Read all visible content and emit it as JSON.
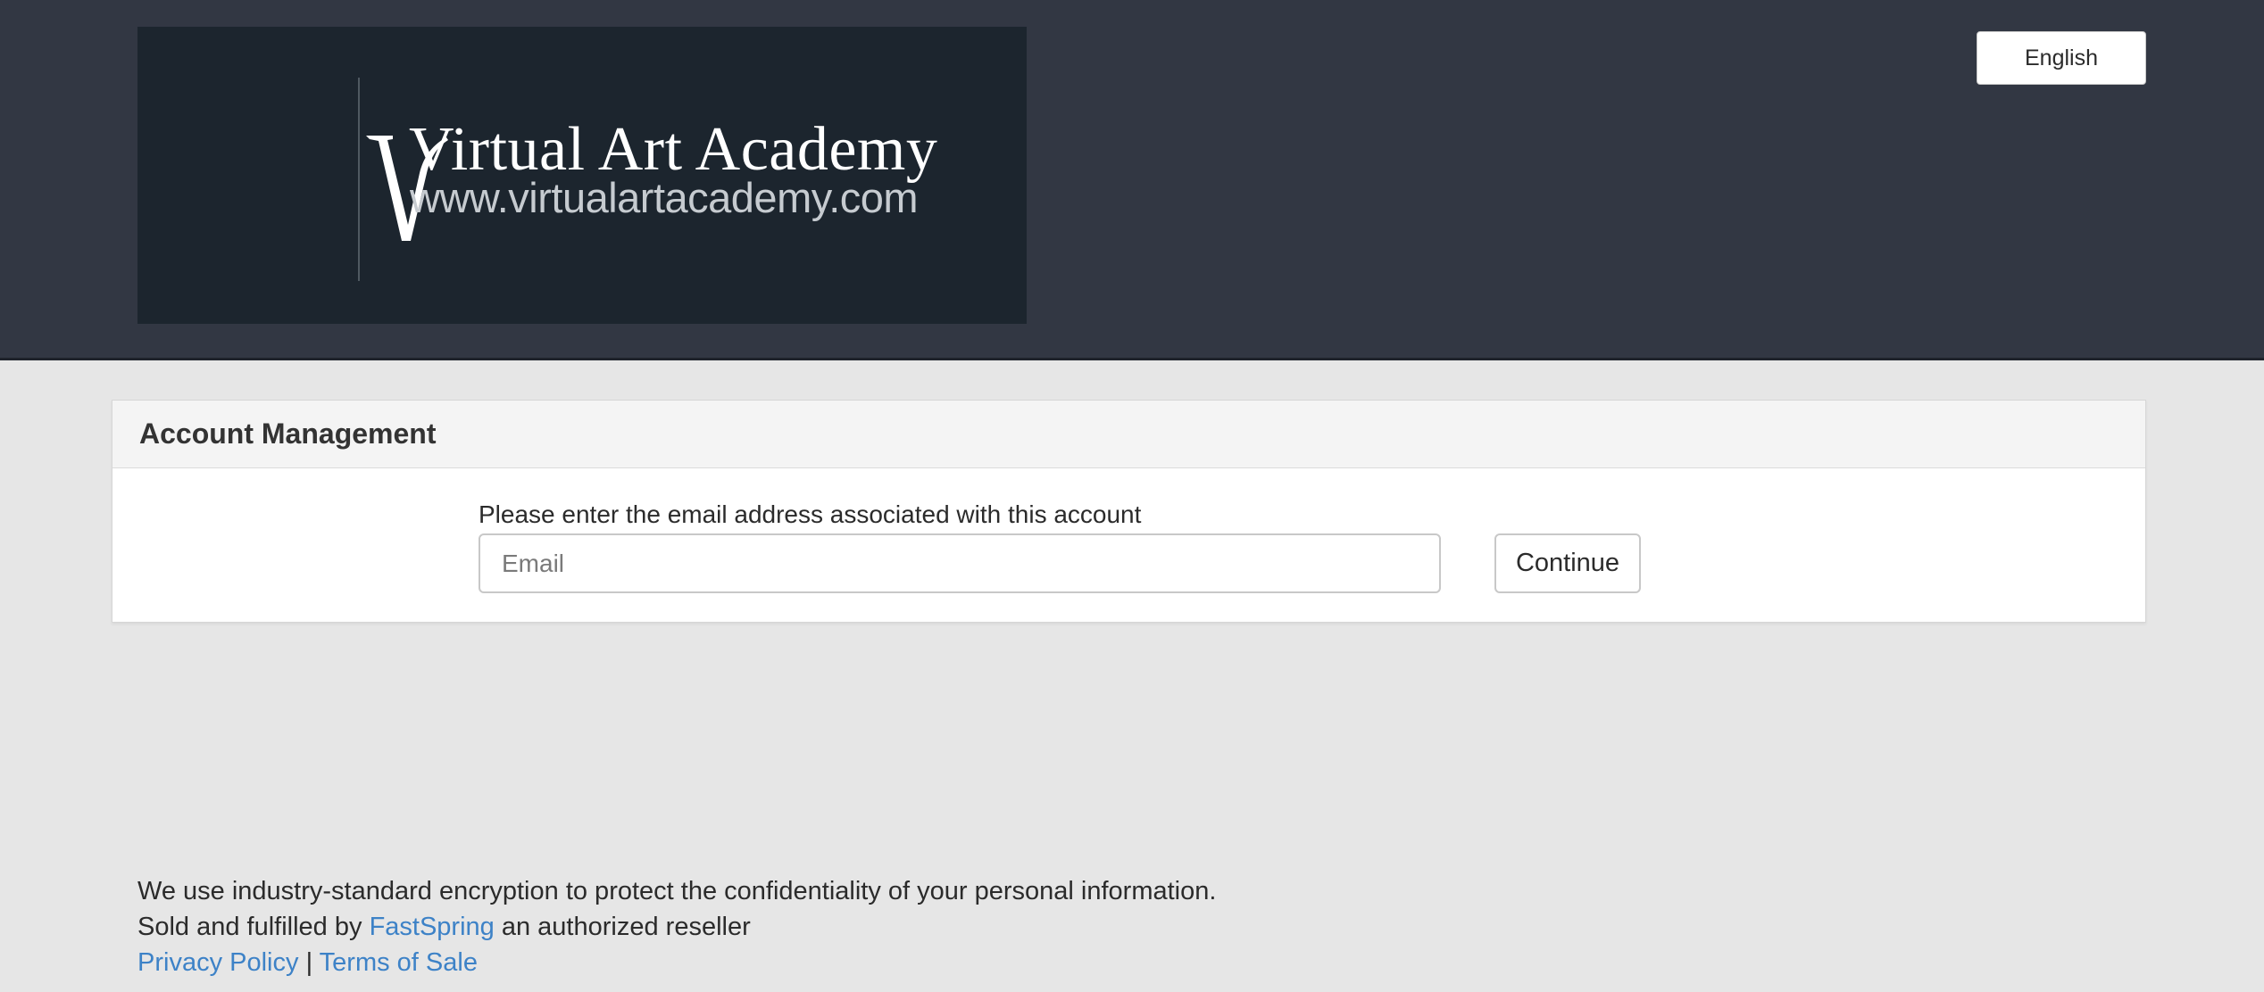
{
  "header": {
    "logo": {
      "mark": "V",
      "title": "Virtual Art Academy",
      "url": "www.virtualartacademy.com"
    },
    "language_button": "English"
  },
  "panel": {
    "title": "Account Management",
    "email_label": "Please enter the email address associated with this account",
    "email_placeholder": "Email",
    "email_value": "",
    "continue_label": "Continue"
  },
  "footer": {
    "encryption_note": "We use industry-standard encryption to protect the confidentiality of your personal information.",
    "sold_prefix": "Sold and fulfilled by",
    "reseller_link": "FastSpring",
    "sold_suffix": "an authorized reseller",
    "privacy_link": "Privacy Policy",
    "separator": "|",
    "terms_link": "Terms of Sale"
  },
  "colors": {
    "header_bg": "#323743",
    "logo_bg": "#1c252e",
    "page_bg": "#e6e6e6",
    "link": "#3d82c7"
  }
}
